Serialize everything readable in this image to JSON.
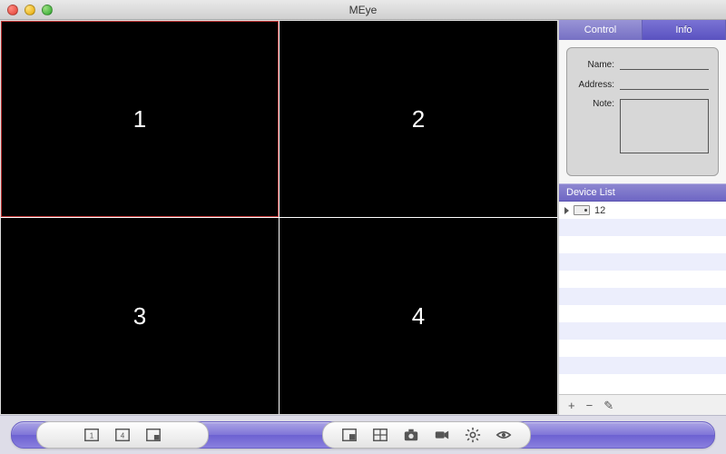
{
  "window": {
    "title": "MEye"
  },
  "grid": {
    "cells": [
      "1",
      "2",
      "3",
      "4"
    ],
    "selected_index": 0
  },
  "sidebar": {
    "tabs": {
      "control": "Control",
      "info": "Info",
      "active": "info"
    },
    "info_panel": {
      "name_label": "Name:",
      "address_label": "Address:",
      "note_label": "Note:",
      "name_value": "",
      "address_value": "",
      "note_value": ""
    },
    "device_list": {
      "header": "Device List",
      "items": [
        {
          "label": "12"
        }
      ],
      "blank_rows": 9
    },
    "list_actions": {
      "add": "+",
      "remove": "−",
      "edit": "✎"
    }
  },
  "toolbar": {
    "icons_left": [
      "layout-1-icon",
      "layout-4-icon",
      "fullscreen-icon"
    ],
    "icons_right": [
      "pip-icon",
      "grid-icon",
      "snapshot-icon",
      "record-icon",
      "settings-icon",
      "eye-icon"
    ]
  },
  "colors": {
    "accent": "#7a73d4"
  }
}
